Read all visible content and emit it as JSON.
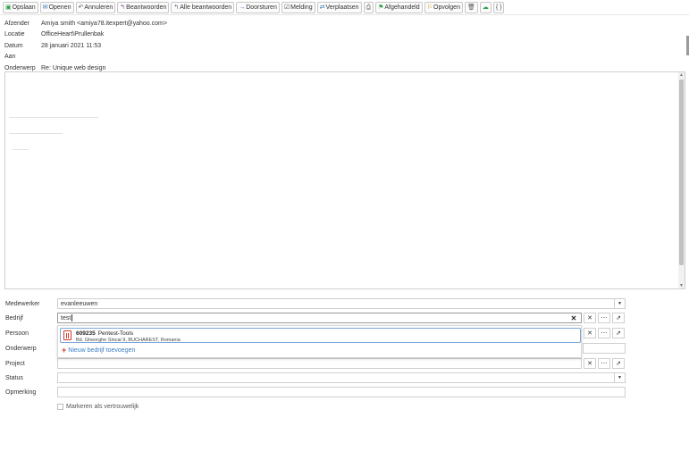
{
  "toolbar": {
    "save": "Opslaan",
    "open": "Openen",
    "cancel": "Annuleren",
    "reply": "Beantwoorden",
    "reply_all": "Alle beantwoorden",
    "forward": "Doorsturen",
    "notify": "Melding",
    "move": "Verplaatsen",
    "completed": "Afgehandeld",
    "followup": "Opvolgen"
  },
  "header": {
    "from_label": "Afzender",
    "from_value": "Amiya smith <amiya78.itexpert@yahoo.com>",
    "location_label": "Locatie",
    "location_value": "OfficeHeart\\Prullenbak",
    "date_label": "Datum",
    "date_value": "28 januari 2021 11:53",
    "to_label": "Aan",
    "to_value": "",
    "subject_label": "Onderwerp",
    "subject_value": "Re: Unique web design"
  },
  "form": {
    "employee_label": "Medewerker",
    "employee_value": "evanleeuwen",
    "company_label": "Bedrijf",
    "company_value": "test",
    "person_label": "Persoon",
    "subject_label": "Onderwerp",
    "project_label": "Project",
    "status_label": "Status",
    "remark_label": "Opmerking",
    "confidential_label": "Markeren als vertrouwelijk"
  },
  "dropdown": {
    "result": {
      "id": "609235",
      "name": "Pentest-Tools",
      "address": "Bd. Gheorghe Sincai 9, BUCHAREST, Romania"
    },
    "new_company": "Nieuw bedrijf toevoegen"
  },
  "colors": {
    "accent_blue": "#3a7cc4",
    "icon_red": "#d0392b",
    "flag_green": "#2e9e48"
  }
}
